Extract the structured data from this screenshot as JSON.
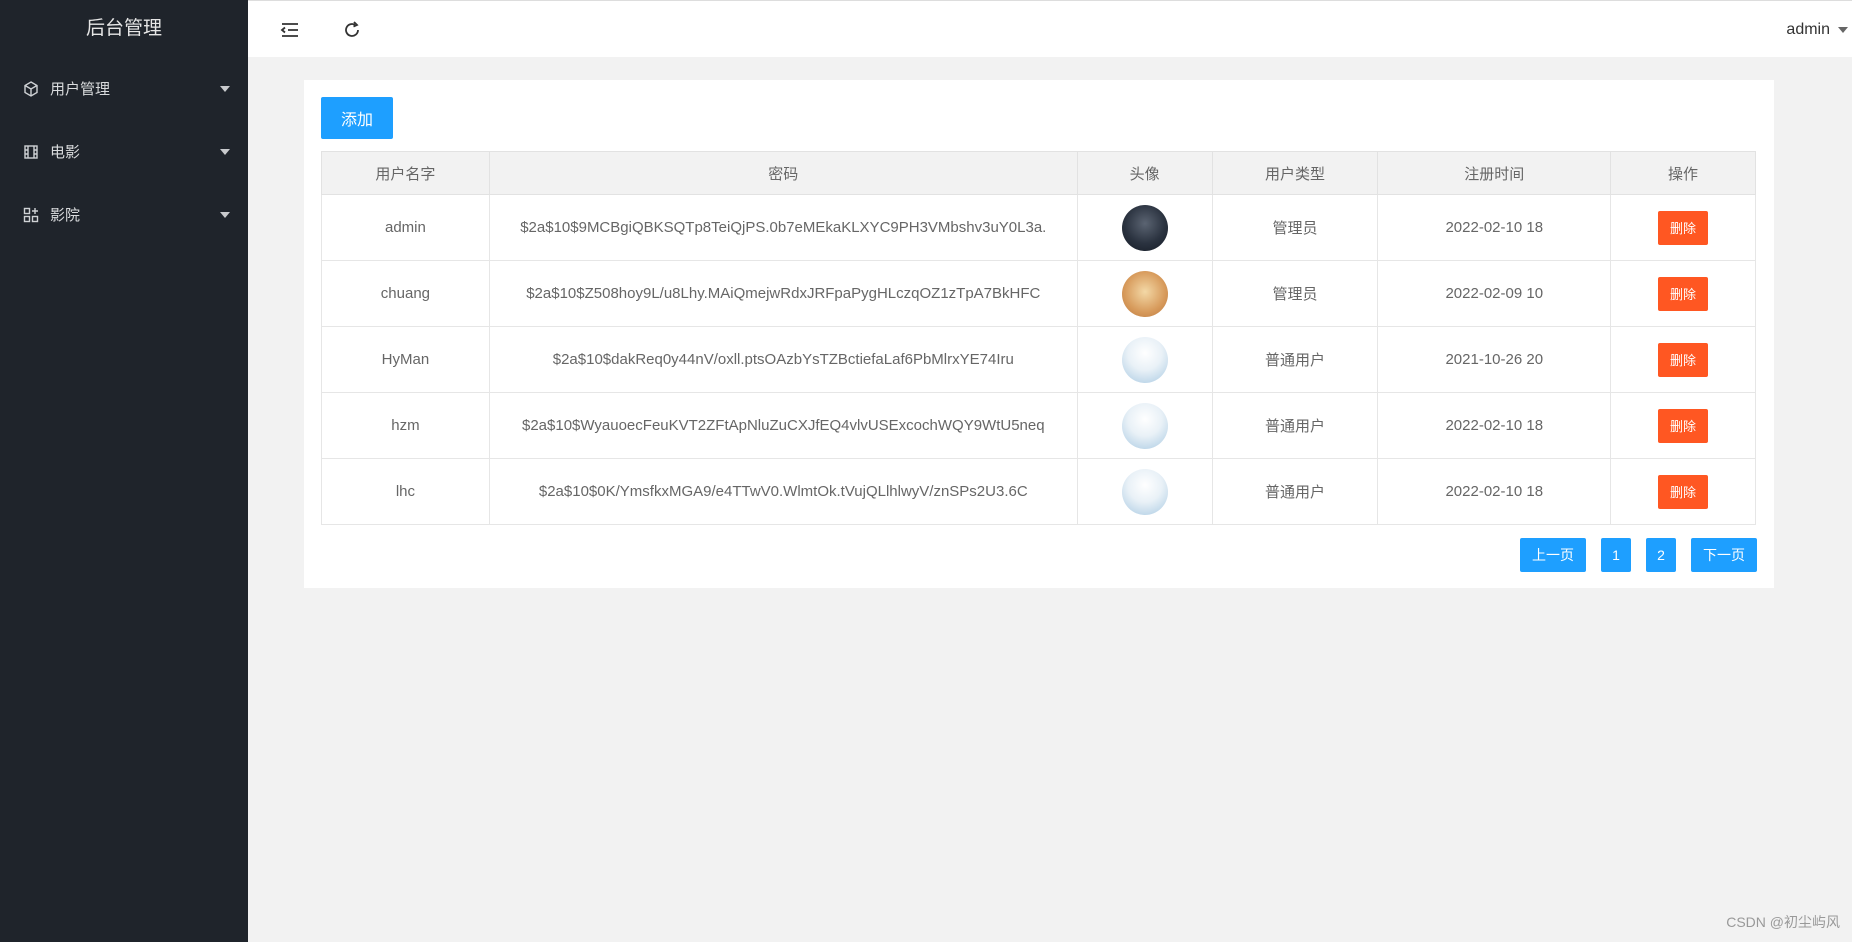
{
  "sidebar": {
    "title": "后台管理",
    "items": [
      {
        "label": "用户管理",
        "icon": "cube-icon"
      },
      {
        "label": "电影",
        "icon": "film-icon"
      },
      {
        "label": "影院",
        "icon": "grid-icon"
      }
    ]
  },
  "header": {
    "user": "admin"
  },
  "toolbar": {
    "add_label": "添加"
  },
  "table": {
    "columns": [
      "用户名字",
      "密码",
      "头像",
      "用户类型",
      "注册时间",
      "操作"
    ],
    "rows": [
      {
        "name": "admin",
        "password": "$2a$10$9MCBgiQBKSQTp8TeiQjPS.0b7eMEkaKLXYC9PH3VMbshv3uY0L3a.",
        "avatar": "dark",
        "type": "管理员",
        "time": "2022-02-10 18",
        "action": "删除"
      },
      {
        "name": "chuang",
        "password": "$2a$10$Z508hoy9L/u8Lhy.MAiQmejwRdxJRFpaPygHLczqOZ1zTpA7BkHFC",
        "avatar": "cat",
        "type": "管理员",
        "time": "2022-02-09 10",
        "action": "删除"
      },
      {
        "name": "HyMan",
        "password": "$2a$10$dakReq0y44nV/oxll.ptsOAzbYsTZBctiefaLaf6PbMlrxYE74Iru",
        "avatar": "duck",
        "type": "普通用户",
        "time": "2021-10-26 20",
        "action": "删除"
      },
      {
        "name": "hzm",
        "password": "$2a$10$WyauoecFeuKVT2ZFtApNluZuCXJfEQ4vlvUSExcochWQY9WtU5neq",
        "avatar": "duck",
        "type": "普通用户",
        "time": "2022-02-10 18",
        "action": "删除"
      },
      {
        "name": "lhc",
        "password": "$2a$10$0K/YmsfkxMGA9/e4TTwV0.WlmtOk.tVujQLlhlwyV/znSPs2U3.6C",
        "avatar": "duck",
        "type": "普通用户",
        "time": "2022-02-10 18",
        "action": "删除"
      }
    ]
  },
  "pager": {
    "prev": "上一页",
    "pages": [
      "1",
      "2"
    ],
    "next": "下一页"
  },
  "watermark": "CSDN @初尘屿风",
  "colors": {
    "sidebar_bg": "#1f242b",
    "primary": "#1e9fff",
    "danger": "#ff5722"
  }
}
